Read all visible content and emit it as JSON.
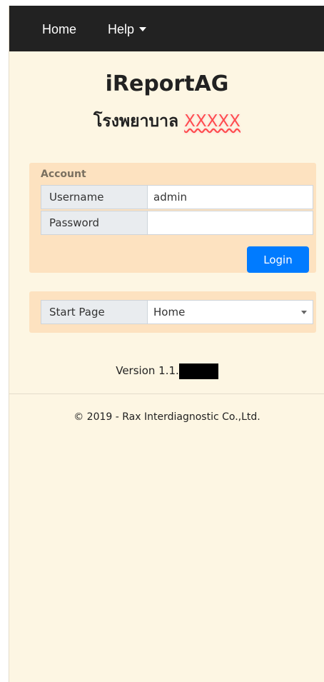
{
  "nav": {
    "home_label": "Home",
    "help_label": "Help"
  },
  "header": {
    "app_title": "iReportAG",
    "hospital_prefix": "โรงพยาบาล",
    "hospital_name_redacted": "XXXXX"
  },
  "account": {
    "legend": "Account",
    "username_label": "Username",
    "username_value": "admin",
    "password_label": "Password",
    "password_value": "",
    "login_label": "Login"
  },
  "start_page": {
    "label": "Start Page",
    "selected": "Home"
  },
  "footer": {
    "version_prefix": "Version 1.1.",
    "copyright": "© 2019 - Rax Interdiagnostic Co.,Ltd."
  },
  "colors": {
    "navbar": "#222222",
    "background": "#fdf6e3",
    "panel": "#fde2c0",
    "primary_button": "#007bff"
  }
}
